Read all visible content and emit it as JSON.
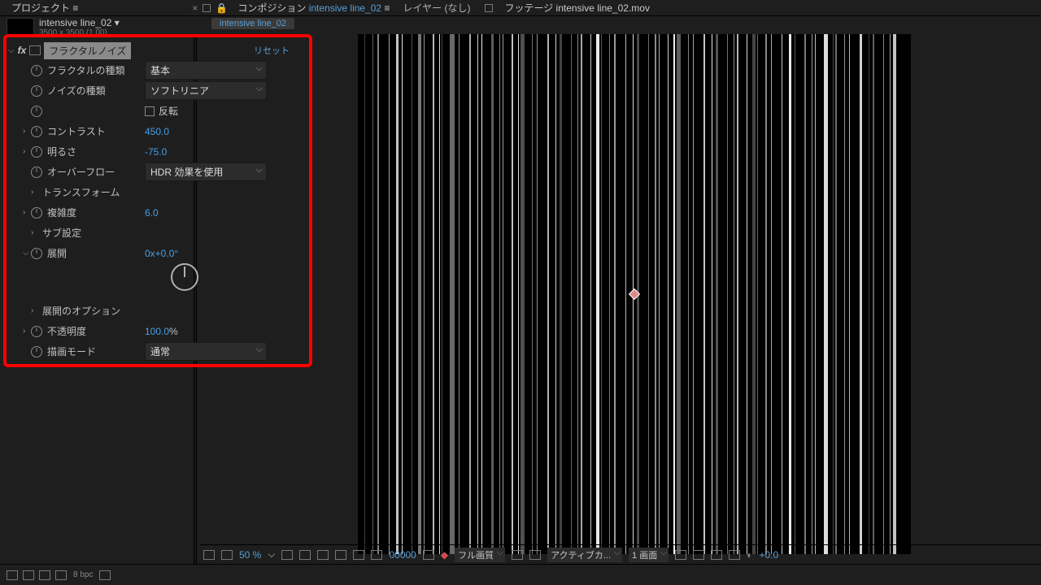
{
  "tabs": {
    "project": "プロジェクト",
    "menu_glyph": "≡",
    "comp_prefix": "コンポジション",
    "comp_name": "intensive line_02",
    "layer": "レイヤー (なし)",
    "footage_prefix": "フッテージ",
    "footage_name": "intensive line_02.mov",
    "sub_tab": "intensive line_02"
  },
  "project_item": {
    "name": "intensive line_02 ▾",
    "dims": "3500 x 3500 (1.00)"
  },
  "effect": {
    "fx_glyph": "fx",
    "name": "フラクタルノイズ",
    "reset": "リセット",
    "props": {
      "fractal_type": {
        "label": "フラクタルの種類",
        "value": "基本"
      },
      "noise_type": {
        "label": "ノイズの種類",
        "value": "ソフトリニア"
      },
      "invert": {
        "label": "反転"
      },
      "contrast": {
        "label": "コントラスト",
        "value": "450.0"
      },
      "brightness": {
        "label": "明るさ",
        "value": "-75.0"
      },
      "overflow": {
        "label": "オーバーフロー",
        "value": "HDR 効果を使用"
      },
      "transform": {
        "label": "トランスフォーム"
      },
      "complexity": {
        "label": "複雑度",
        "value": "6.0"
      },
      "sub_settings": {
        "label": "サブ設定"
      },
      "evolution": {
        "label": "展開",
        "value": "0x+0.0°"
      },
      "evo_options": {
        "label": "展開のオプション"
      },
      "opacity": {
        "label": "不透明度",
        "value": "100.0",
        "suffix": "%"
      },
      "blend_mode": {
        "label": "描画モード",
        "value": "通常"
      }
    }
  },
  "viewer_bar": {
    "zoom": "50 %",
    "timecode": "00000",
    "quality": "フル画質",
    "camera": "アクティブカ...",
    "views": "1 画面",
    "exposure": "+0.0"
  },
  "footer": {
    "bpc": "8 bpc"
  }
}
